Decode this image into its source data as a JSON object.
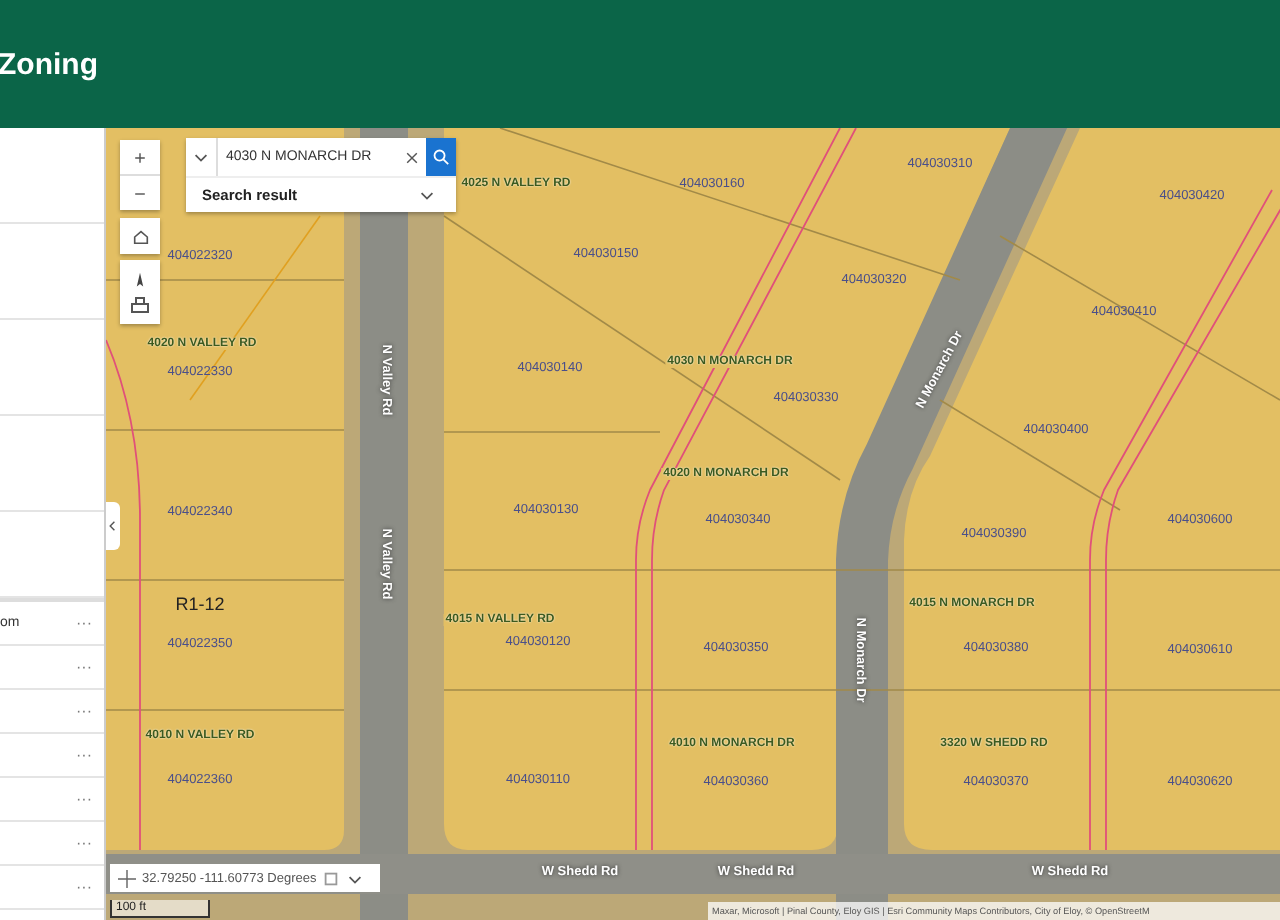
{
  "header": {
    "title": "Zoning"
  },
  "side_panel": {
    "list_rows": [
      {
        "label": "om",
        "menu": "···"
      },
      {
        "menu": "···"
      },
      {
        "menu": "···"
      },
      {
        "menu": "···"
      },
      {
        "menu": "···"
      },
      {
        "menu": "···"
      },
      {
        "menu": "···"
      }
    ]
  },
  "search": {
    "value": "4030 N MONARCH DR",
    "result_label": "Search result"
  },
  "map": {
    "parcel_numbers": [
      "404022320",
      "404022330",
      "404022340",
      "404022350",
      "404022360",
      "404030160",
      "404030150",
      "404030140",
      "404030130",
      "404030120",
      "404030110",
      "404030310",
      "404030320",
      "404030330",
      "404030340",
      "404030350",
      "404030360",
      "404030420",
      "404030410",
      "404030400",
      "404030390",
      "404030380",
      "404030370",
      "404030600",
      "404030610",
      "404030620"
    ],
    "addresses": [
      "4020 N VALLEY RD",
      "4010 N VALLEY RD",
      "4025 N VALLEY RD",
      "4015 N VALLEY RD",
      "4030 N MONARCH DR",
      "4020 N MONARCH DR",
      "4010 N MONARCH DR",
      "4015 N MONARCH DR",
      "3320 W SHEDD RD"
    ],
    "zone_label": "R1-12",
    "streets": [
      {
        "name": "N Valley Rd",
        "kind": "vertical"
      },
      {
        "name": "N Valley Rd",
        "kind": "vertical"
      },
      {
        "name": "N Monarch Dr",
        "kind": "diagonal"
      },
      {
        "name": "N Monarch Dr",
        "kind": "vertical"
      },
      {
        "name": "W Shedd Rd",
        "kind": "horizontal"
      },
      {
        "name": "W Shedd Rd",
        "kind": "horizontal"
      },
      {
        "name": "W Shedd Rd",
        "kind": "horizontal"
      }
    ],
    "coordinates": "32.79250 -111.60773 Degrees",
    "scale_bar": "100 ft",
    "attribution": "Maxar, Microsoft | Pinal County, Eloy GIS | Esri Community Maps Contributors, City of Eloy, © OpenStreetM"
  }
}
